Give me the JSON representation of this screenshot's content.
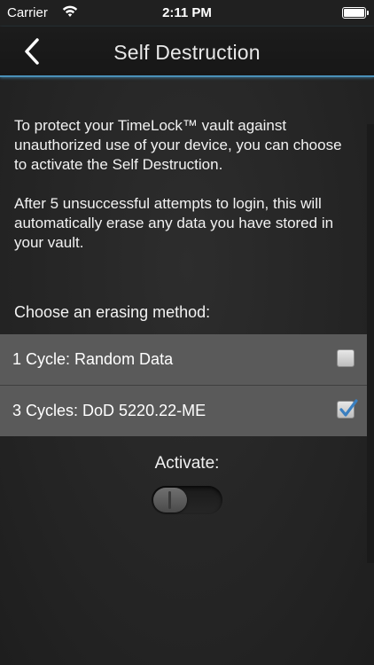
{
  "status_bar": {
    "carrier": "Carrier",
    "time": "2:11 PM",
    "wifi_icon": "wifi-icon",
    "battery_icon": "battery-icon"
  },
  "nav": {
    "title": "Self Destruction",
    "back_icon": "chevron-left-icon",
    "accent_color": "#4a90b8"
  },
  "content": {
    "paragraph_1": "To protect your TimeLock™ vault against unauthorized use of your device, you can choose to activate the Self Destruction.",
    "paragraph_2": "After 5 unsuccessful attempts to login, this will automatically erase any data you have stored in your vault.",
    "method_heading": "Choose an erasing method:",
    "options": [
      {
        "label": "1 Cycle: Random Data",
        "checked": false
      },
      {
        "label": "3 Cycles: DoD 5220.22-ME",
        "checked": true
      }
    ],
    "activate_label": "Activate:",
    "activate_on": false
  },
  "colors": {
    "background": "#262626",
    "row_background": "#5a5a5a",
    "check_color": "#3a7fc0"
  }
}
